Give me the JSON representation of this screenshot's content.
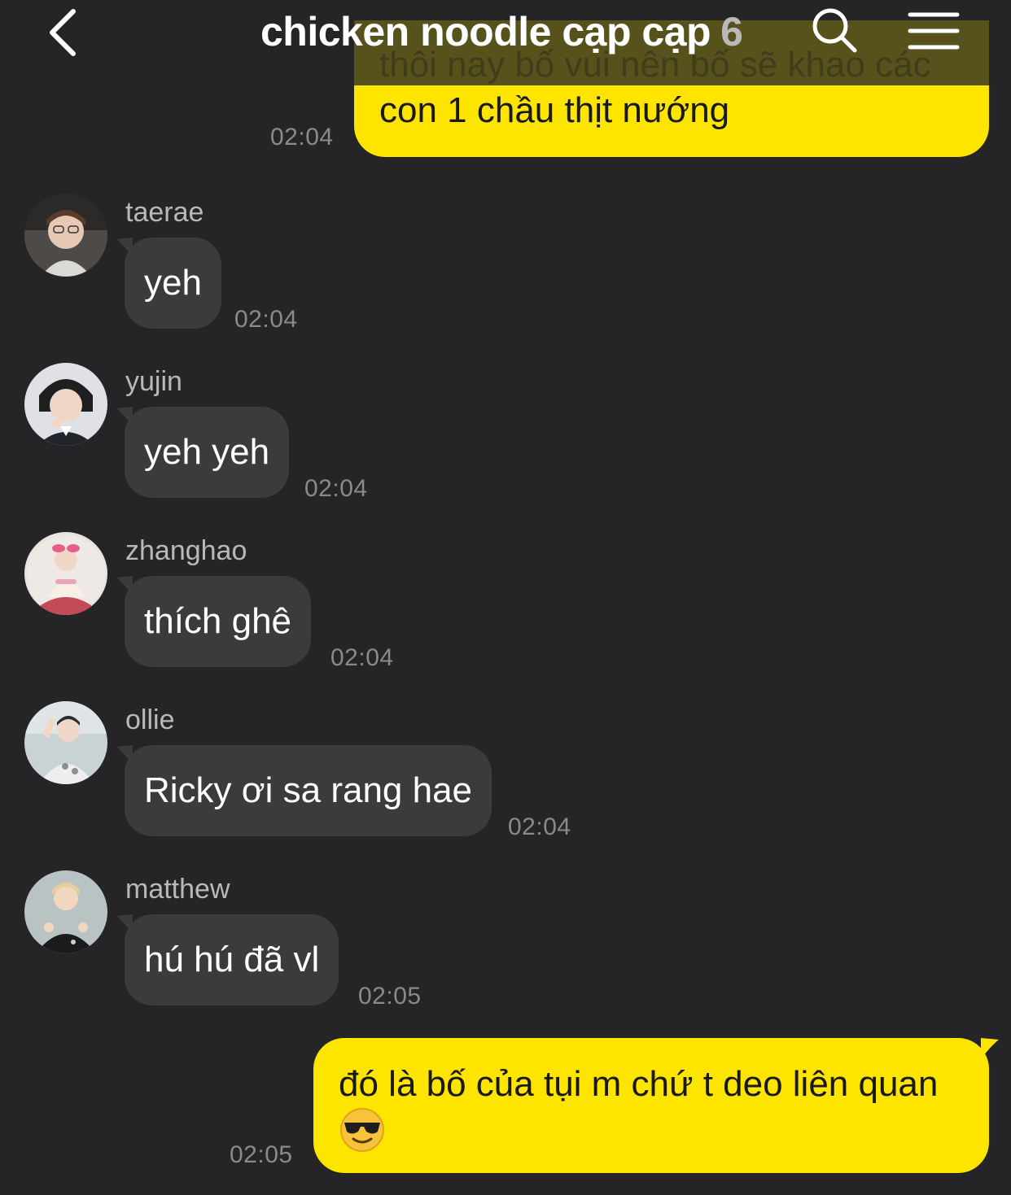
{
  "header": {
    "title": "chicken noodle cạp cạp",
    "member_count": "6",
    "icons": {
      "back": "chevron-left-icon",
      "search": "search-icon",
      "menu": "hamburger-menu-icon"
    }
  },
  "colors": {
    "background": "#252527",
    "outgoing_bubble": "#fee500",
    "incoming_bubble": "#3b3b3e",
    "timestamp": "#8a8a8d"
  },
  "messages": [
    {
      "type": "outgoing",
      "text_hidden": "thôi nay bố vui nên bố sẽ khao các",
      "text": "con 1 chầu thịt nướng",
      "time": "02:04"
    },
    {
      "type": "incoming",
      "sender": "taerae",
      "text": "yeh",
      "time": "02:04"
    },
    {
      "type": "incoming",
      "sender": "yujin",
      "text": "yeh yeh",
      "time": "02:04"
    },
    {
      "type": "incoming",
      "sender": "zhanghao",
      "text": "thích ghê",
      "time": "02:04"
    },
    {
      "type": "incoming",
      "sender": "ollie",
      "text": "Ricky ơi sa rang hae",
      "time": "02:04"
    },
    {
      "type": "incoming",
      "sender": "matthew",
      "text": "hú hú đã vl",
      "time": "02:05"
    },
    {
      "type": "outgoing",
      "text": "đó là bố của tụi m chứ t deo liên quan",
      "emoji": "😎",
      "time": "02:05"
    }
  ]
}
